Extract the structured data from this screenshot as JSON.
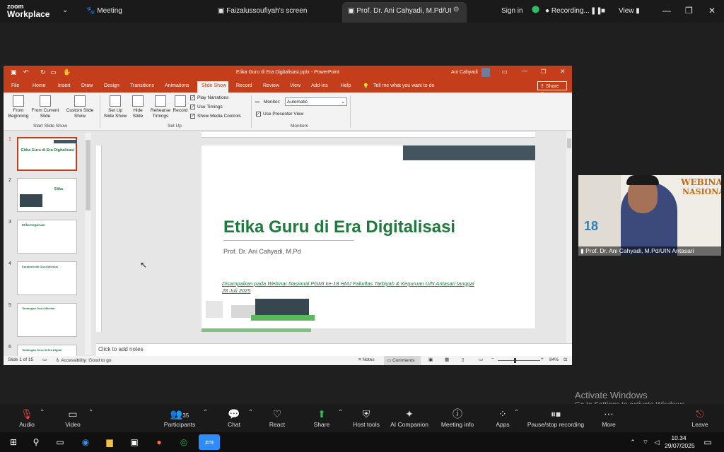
{
  "zoom": {
    "logo_line1": "zoom",
    "logo_line2": "Workplace",
    "meeting_label": "Meeting",
    "tab1": "Faizalussoufiyah's screen",
    "tab2": "Prof. Dr. Ani Cahyadi, M.Pd/UIN A",
    "sign_in": "Sign in",
    "recording": "Recording...",
    "view": "View"
  },
  "ppt": {
    "title": "Etika Guru di Era Digitalisasi.pptx - PowerPoint",
    "user": "Ani Cahyadi",
    "menu": [
      "File",
      "Home",
      "Insert",
      "Draw",
      "Design",
      "Transitions",
      "Animations",
      "Slide Show",
      "Record",
      "Review",
      "View",
      "Add-ins",
      "Help"
    ],
    "tell_me": "Tell me what you want to do",
    "share": "Share",
    "ribbon": {
      "from_beginning": "From Beginning",
      "from_current": "From Current Slide",
      "custom_show": "Custom Slide Show",
      "group_start": "Start Slide Show",
      "setup_show": "Set Up Slide Show",
      "hide_slide": "Hide Slide",
      "rehearse": "Rehearse Timings",
      "record": "Record",
      "play_narrations": "Play Narrations",
      "use_timings": "Use Timings",
      "show_media": "Show Media Controls",
      "group_setup": "Set Up",
      "monitor_label": "Monitor:",
      "monitor_value": "Automatic",
      "presenter_view": "Use Presenter View",
      "group_monitors": "Monitors"
    },
    "slide_numbers": [
      "1",
      "2",
      "3",
      "4",
      "5",
      "6"
    ],
    "thumb_titles": [
      "Etika Guru di Era Digitalisasi",
      "Etika",
      "Etika Keguruan",
      "Karakteristik Guru Milenial",
      "Tantangan Guru Milenial",
      "Tantangan Guru di Era Digital"
    ],
    "slide": {
      "title": "Etika Guru di Era Digitalisasi",
      "author": "Prof. Dr. Ani Cahyadi, M.Pd",
      "note": "Disampaikan pada Webinar Nasional PGMI ke-18 HMJ Fakultas Tarbiyah & Keguruan UIN Antasari tanggal 28 Juli 2025"
    },
    "notes_placeholder": "Click to add notes",
    "status": {
      "slide_of": "Slide 1 of 15",
      "accessibility": "Accessibility: Good to go",
      "notes": "Notes",
      "comments": "Comments",
      "zoom": "84%"
    }
  },
  "video": {
    "banner1": "WEBINAR",
    "banner2": "NASIONAL",
    "name": "Prof. Dr. Ani Cahyadi, M.Pd/UIN Antasari"
  },
  "activate": {
    "line1": "Activate Windows",
    "line2": "Go to Settings to activate Windows."
  },
  "toolbar": {
    "audio": "Audio",
    "video": "Video",
    "participants": "Participants",
    "participants_count": "35",
    "chat": "Chat",
    "react": "React",
    "share": "Share",
    "host_tools": "Host tools",
    "ai": "AI Companion",
    "meeting_info": "Meeting info",
    "apps": "Apps",
    "pause": "Pause/stop recording",
    "more": "More",
    "leave": "Leave"
  },
  "taskbar": {
    "time": "10.34",
    "date": "29/07/2025"
  }
}
